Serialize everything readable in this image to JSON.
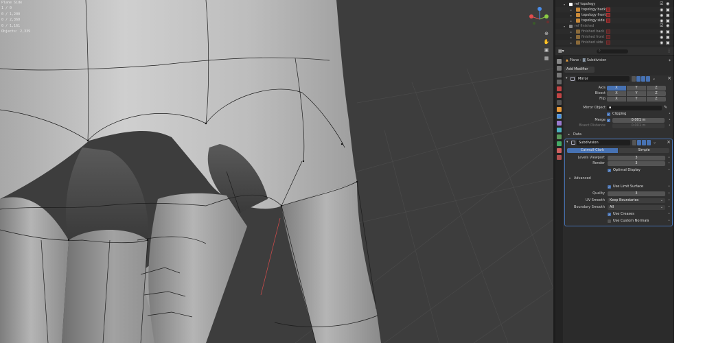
{
  "viewport": {
    "stats": [
      "Plane Side",
      "1 / 0",
      "0 / 1,200",
      "0 / 2,360",
      "0 / 1,161",
      "Objects: 2,339"
    ],
    "gizmo": {
      "x_color": "#e04d4d",
      "y_color": "#8ccc44",
      "z_color": "#4a8eea"
    },
    "nav_icons": [
      "zoom-icon",
      "pan-icon",
      "camera-icon",
      "grid-icon"
    ]
  },
  "outliner": {
    "rows": [
      {
        "label": "ref topology",
        "level": 0,
        "dim": false
      },
      {
        "label": "topology back",
        "level": 1,
        "dim": false
      },
      {
        "label": "topology front",
        "level": 1,
        "dim": false
      },
      {
        "label": "topology side",
        "level": 1,
        "dim": false
      },
      {
        "label": "ref finished",
        "level": 0,
        "dim": true
      },
      {
        "label": "finished back",
        "level": 1,
        "dim": true
      },
      {
        "label": "finished front",
        "level": 1,
        "dim": true
      },
      {
        "label": "finished side",
        "level": 1,
        "dim": true
      }
    ]
  },
  "properties": {
    "breadcrumb_object": "Plane",
    "breadcrumb_modifier": "Subdivision",
    "add_modifier": "Add Modifier",
    "mirror": {
      "name": "Mirror",
      "axis_label": "Axis",
      "bisect_label": "Bisect",
      "flip_label": "Flip",
      "x": "X",
      "y": "Y",
      "z": "Z",
      "mirror_object_label": "Mirror Object",
      "clipping_label": "Clipping",
      "merge_label": "Merge",
      "merge_value": "0.001 m",
      "bisect_distance_label": "Bisect Distance",
      "bisect_distance_value": "0.001 m",
      "data_label": "Data"
    },
    "subdivision": {
      "name": "Subdivision",
      "catmull_label": "Catmull-Clark",
      "simple_label": "Simple",
      "levels_viewport_label": "Levels Viewport",
      "levels_viewport_value": "3",
      "render_label": "Render",
      "render_value": "3",
      "optimal_display_label": "Optimal Display",
      "advanced_label": "Advanced",
      "use_limit_surface_label": "Use Limit Surface",
      "quality_label": "Quality",
      "quality_value": "3",
      "uv_smooth_label": "UV Smooth",
      "uv_smooth_value": "Keep Boundaries",
      "boundary_smooth_label": "Boundary Smooth",
      "boundary_smooth_value": "All",
      "use_creases_label": "Use Creases",
      "use_custom_normals_label": "Use Custom Normals"
    }
  }
}
